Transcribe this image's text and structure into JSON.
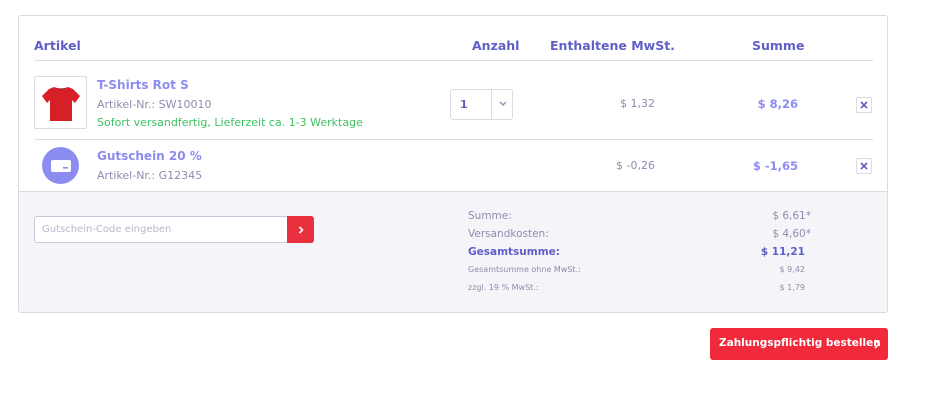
{
  "headers": {
    "article": "Artikel",
    "quantity": "Anzahl",
    "vat": "Enthaltene MwSt.",
    "sum": "Summe"
  },
  "items": [
    {
      "name": "T-Shirts Rot S",
      "number": "Artikel-Nr.: SW10010",
      "shipping": "Sofort versandfertig, Lieferzeit ca. 1-3 Werktage",
      "quantity": "1",
      "vat": "$ 1,32",
      "sum": "$ 8,26",
      "icon": "red-tshirt-icon"
    },
    {
      "name": "Gutschein 20 %",
      "number": "Artikel-Nr.: G12345",
      "vat": "$ -0,26",
      "sum": "$ -1,65",
      "icon": "voucher-icon"
    }
  ],
  "voucher": {
    "placeholder": "Gutschein-Code eingeben"
  },
  "totals": {
    "subtotal_label": "Summe:",
    "subtotal_value": "$ 6,61*",
    "shipping_label": "Versandkosten:",
    "shipping_value": "$ 4,60*",
    "total_label": "Gesamtsumme:",
    "total_value": "$ 11,21",
    "net_label": "Gesamtsumme ohne MwSt.:",
    "net_value": "$ 9,42",
    "tax_label": "zzgl. 19 % MwSt.:",
    "tax_value": "$ 1,79"
  },
  "order_button": "Zahlungspflichtig bestellen",
  "colors": {
    "accent": "#5f5fc7",
    "light_accent": "#8c8cf0",
    "cta": "#f0293b",
    "success": "#3cc261"
  }
}
